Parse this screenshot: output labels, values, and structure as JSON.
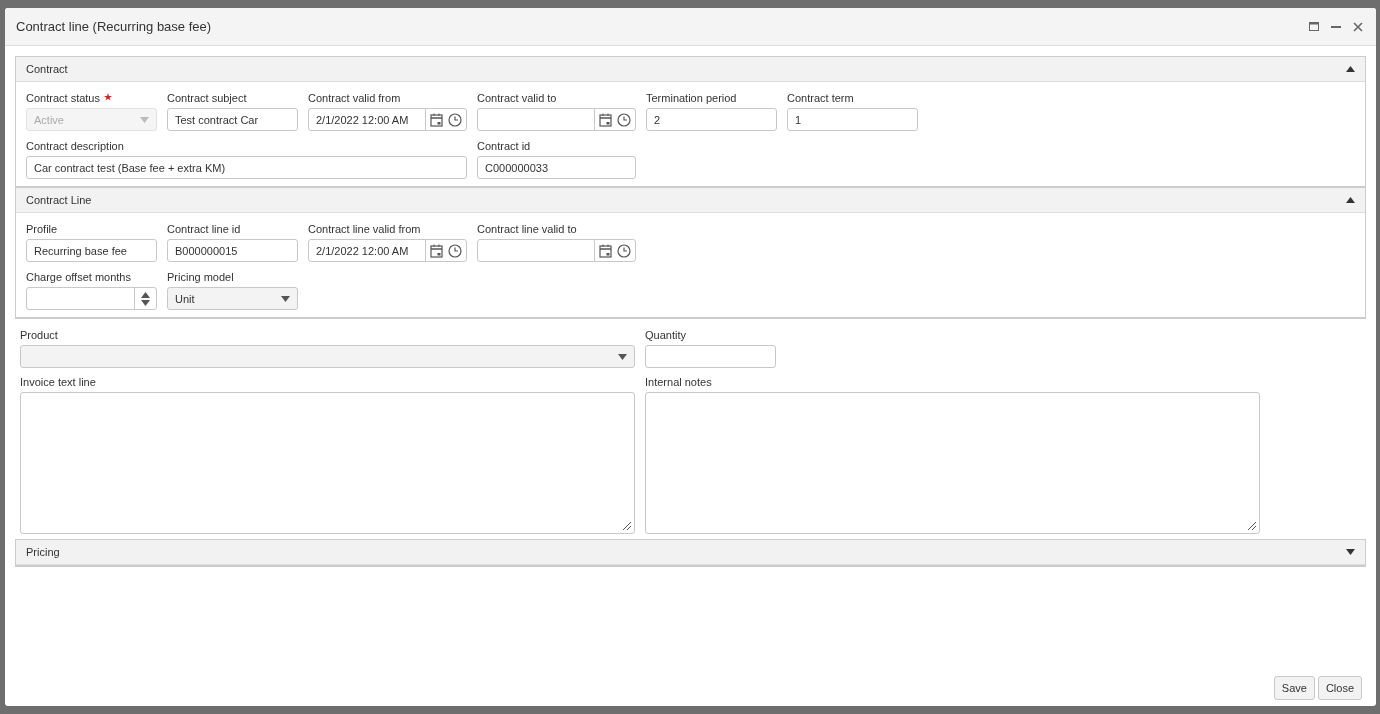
{
  "window": {
    "title": "Contract line (Recurring base fee)"
  },
  "sections": [
    {
      "title": "Contract",
      "expanded": true,
      "fields": [
        {
          "kind": "select",
          "label": "Contract status",
          "required": true,
          "value": "Active",
          "disabled": true
        },
        {
          "kind": "text",
          "label": "Contract subject",
          "value": "Test contract Car"
        },
        {
          "kind": "datetime",
          "label": "Contract valid from",
          "value": "2/1/2022 12:00 AM"
        },
        {
          "kind": "datetime",
          "label": "Contract valid to"
        },
        {
          "kind": "text",
          "label": "Termination period",
          "value": "2"
        },
        {
          "kind": "text",
          "label": "Contract term",
          "value": "1"
        },
        {
          "kind": "text",
          "label": "Contract description",
          "value": "Car contract test (Base fee + extra KM)"
        },
        {
          "kind": "text",
          "label": "Contract id",
          "value": "C000000033"
        }
      ]
    },
    {
      "title": "Contract Line",
      "expanded": true,
      "fields": [
        {
          "kind": "text",
          "label": "Profile",
          "value": "Recurring base fee"
        },
        {
          "kind": "text",
          "label": "Contract line id",
          "value": "B000000015"
        },
        {
          "kind": "datetime",
          "label": "Contract line valid from",
          "value": "2/1/2022 12:00 AM"
        },
        {
          "kind": "datetime",
          "label": "Contract line valid to"
        },
        {
          "kind": "number",
          "label": "Charge offset months"
        },
        {
          "kind": "select",
          "label": "Pricing model",
          "value": "Unit",
          "disabled": false
        }
      ]
    }
  ],
  "details": [
    {
      "kind": "select",
      "label": "Product",
      "disabled": false
    },
    {
      "kind": "text",
      "label": "Quantity"
    },
    {
      "kind": "textarea",
      "label": "Invoice text line"
    },
    {
      "kind": "textarea",
      "label": "Internal notes"
    }
  ],
  "pricing": {
    "title": "Pricing",
    "expanded": false
  },
  "buttons": [
    "Save",
    "Close"
  ]
}
